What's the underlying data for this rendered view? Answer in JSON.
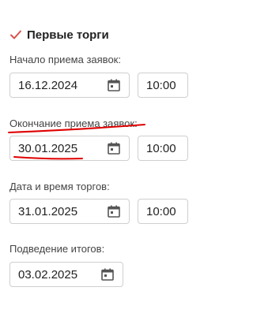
{
  "first_auction": {
    "checkbox_checked": true,
    "title": "Первые торги"
  },
  "fields": {
    "start": {
      "label": "Начало приема заявок:",
      "date": "16.12.2024",
      "time": "10:00"
    },
    "end": {
      "label": "Окончание приема заявок:",
      "date": "30.01.2025",
      "time": "10:00"
    },
    "auction": {
      "label": "Дата и время торгов:",
      "date": "31.01.2025",
      "time": "10:00"
    },
    "results": {
      "label": "Подведение итогов:",
      "date": "03.02.2025"
    }
  },
  "icons": {
    "calendar": "calendar-icon",
    "checkbox": "checkmark-icon"
  },
  "colors": {
    "checkmark": "#d9534f",
    "annotation": "#e00000",
    "icon": "#555555"
  }
}
